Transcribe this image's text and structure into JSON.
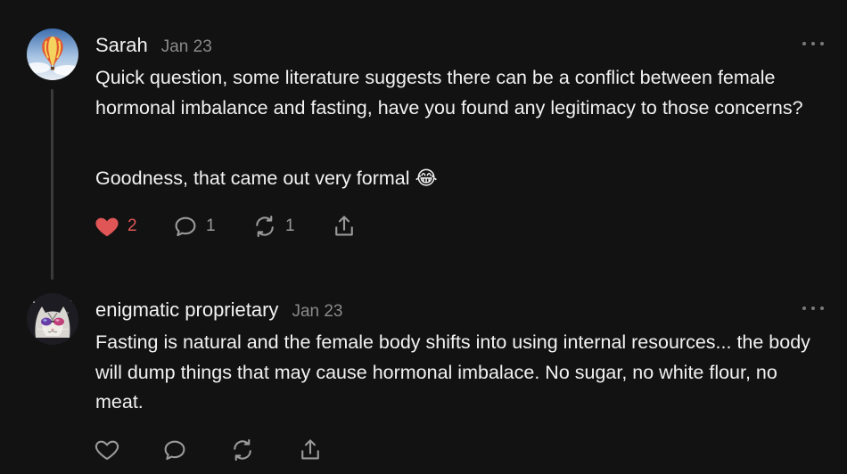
{
  "comments": [
    {
      "author": "Sarah",
      "date": "Jan 23",
      "avatar": "hot-air-balloon",
      "paragraphs": [
        "Quick question, some literature suggests there can be a conflict between female hormonal imbalance and fasting, have you found any legitimacy to those concerns?",
        "Goodness, that came out very formal 😂"
      ],
      "actions": {
        "like_count": "2",
        "liked": true,
        "reply_count": "1",
        "restack_count": "1"
      }
    },
    {
      "author": "enigmatic proprietary",
      "date": "Jan 23",
      "avatar": "cat-with-sunglasses",
      "paragraphs": [
        "Fasting is natural and the female body shifts into using internal resources... the body will dump things that may cause hormonal imbalace. No sugar, no white flour, no meat."
      ],
      "actions": {
        "like_count": "",
        "liked": false,
        "reply_count": "",
        "restack_count": ""
      }
    }
  ],
  "colors": {
    "background": "#121212",
    "text": "#f2f2f2",
    "muted": "#8a8a8a",
    "like_active": "#e05656",
    "icon": "#9a9a9a",
    "thread_line": "#3a3a3a"
  }
}
